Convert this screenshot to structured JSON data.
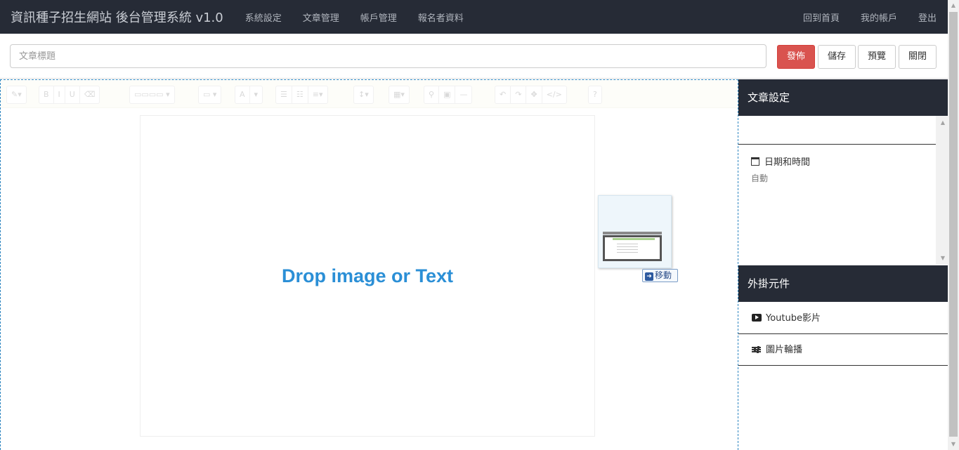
{
  "navbar": {
    "brand": "資訊種子招生網站 後台管理系統 v1.0",
    "left_items": [
      "系統設定",
      "文章管理",
      "帳戶管理",
      "報名者資料"
    ],
    "right_items": [
      "回到首頁",
      "我的帳戶",
      "登出"
    ]
  },
  "titlebar": {
    "title_placeholder": "文章標題",
    "publish_label": "發佈",
    "save_label": "儲存",
    "preview_label": "預覽",
    "close_label": "關閉"
  },
  "editor": {
    "drop_text": "Drop image or Text",
    "move_badge": "移動"
  },
  "sidebar": {
    "settings_title": "文章設定",
    "datetime_label": "日期和時間",
    "datetime_value": "自動",
    "plugins_title": "外掛元件",
    "plugins": [
      "Youtube影片",
      "圖片輪播"
    ]
  },
  "colors": {
    "navbar_bg": "#262b36",
    "publish_button": "#d9534f",
    "drop_text": "#2b8fd6",
    "editor_border": "#2e86c1"
  }
}
